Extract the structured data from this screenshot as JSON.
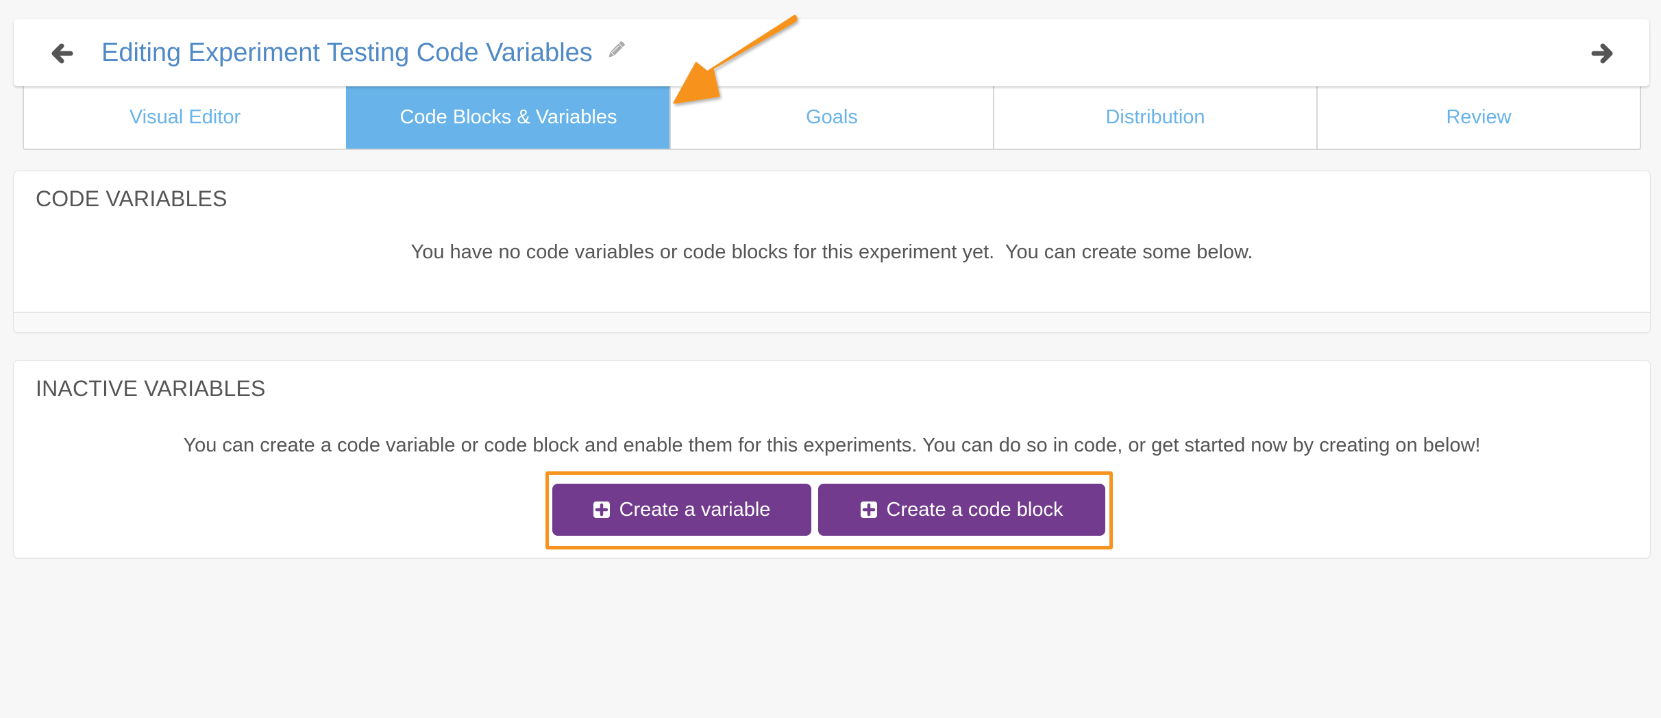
{
  "header": {
    "title": "Editing Experiment Testing Code Variables",
    "back_icon": "arrow-left-icon",
    "forward_icon": "arrow-right-icon",
    "edit_icon": "pencil-icon"
  },
  "tabs": [
    {
      "label": "Visual Editor",
      "active": false
    },
    {
      "label": "Code Blocks & Variables",
      "active": true
    },
    {
      "label": "Goals",
      "active": false
    },
    {
      "label": "Distribution",
      "active": false
    },
    {
      "label": "Review",
      "active": false
    }
  ],
  "code_variables": {
    "heading": "CODE VARIABLES",
    "message": "You have no code variables or code blocks for this experiment yet.  You can create some below."
  },
  "inactive_variables": {
    "heading": "INACTIVE VARIABLES",
    "message": "You can create a code variable or code block and enable them for this experiments. You can do so in code, or get started now by creating on below!",
    "buttons": [
      {
        "label": "Create a variable",
        "icon": "plus-square-icon"
      },
      {
        "label": "Create a code block",
        "icon": "plus-square-icon"
      }
    ]
  },
  "colors": {
    "title": "#4f89c6",
    "tab_active_bg": "#68b3e9",
    "button_bg": "#723b8d",
    "annotation": "#f7931e"
  }
}
